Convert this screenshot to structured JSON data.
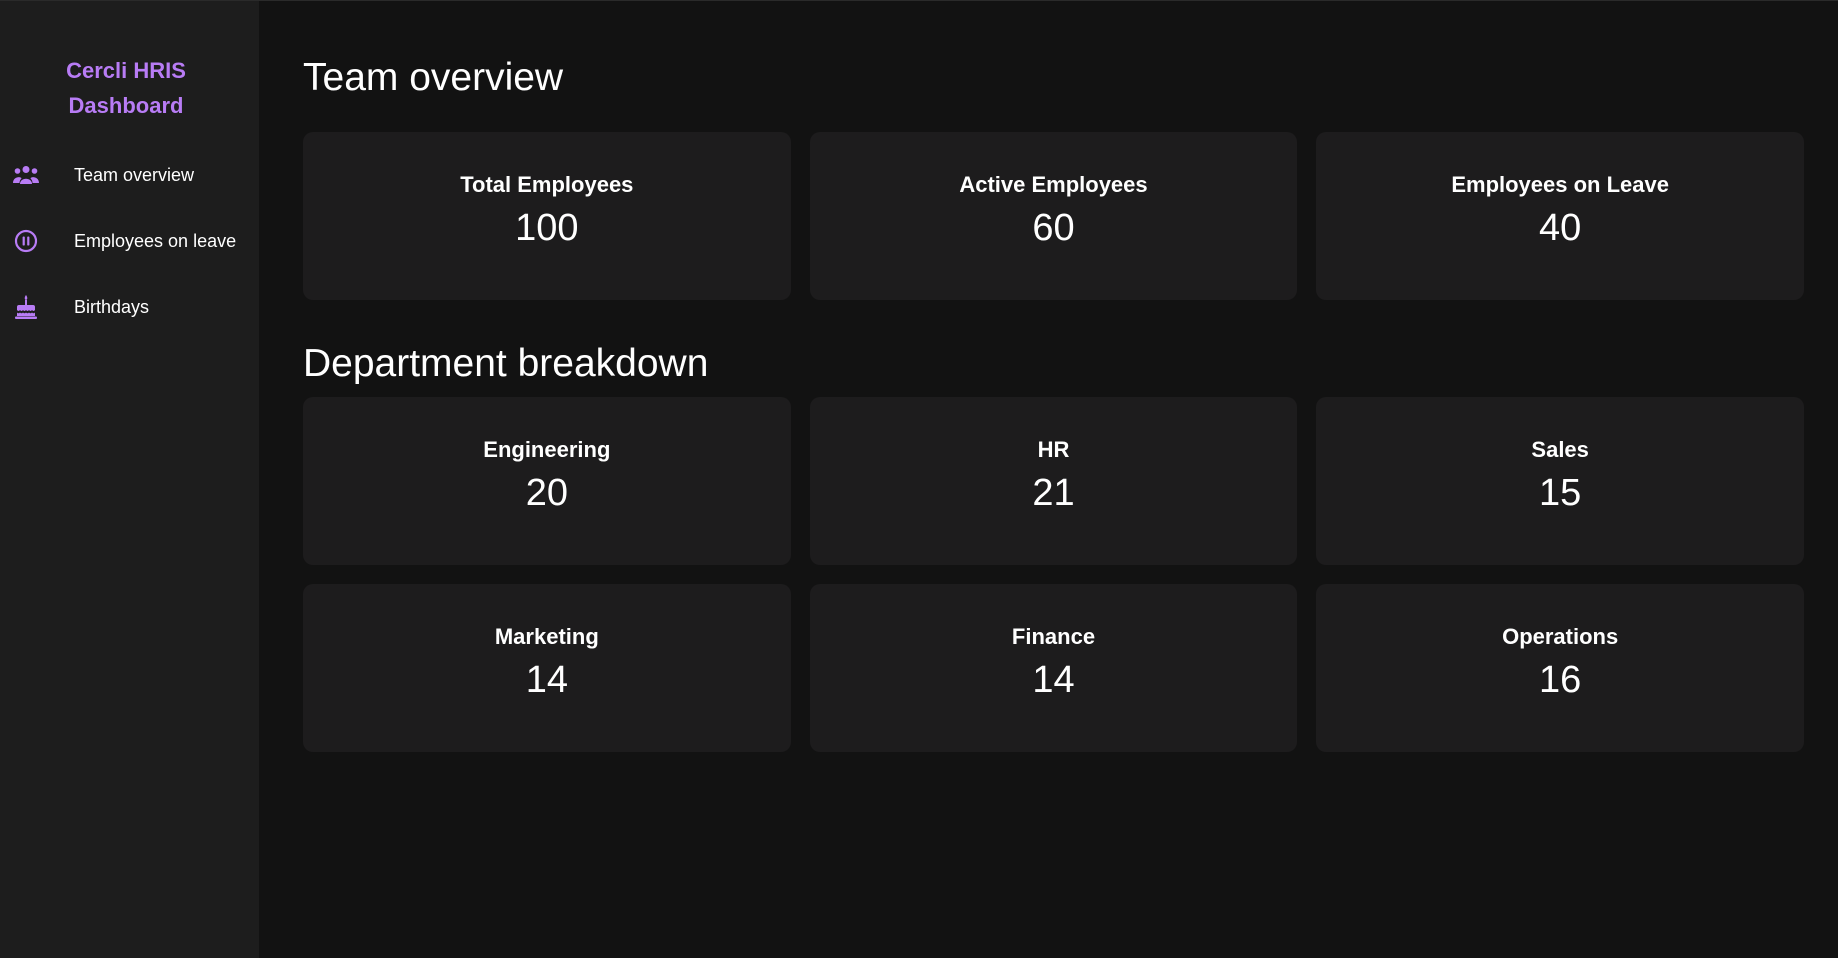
{
  "sidebar": {
    "brand_line1": "Cercli HRIS",
    "brand_line2": "Dashboard",
    "accent_color": "#b87cf5",
    "items": [
      {
        "label": "Team overview",
        "icon": "team-icon"
      },
      {
        "label": "Employees on leave",
        "icon": "pause-circle-icon"
      },
      {
        "label": "Birthdays",
        "icon": "birthday-cake-icon"
      }
    ]
  },
  "overview": {
    "title": "Team overview",
    "cards": [
      {
        "label": "Total Employees",
        "value": "100"
      },
      {
        "label": "Active Employees",
        "value": "60"
      },
      {
        "label": "Employees on Leave",
        "value": "40"
      }
    ]
  },
  "departments": {
    "title": "Department breakdown",
    "cards": [
      {
        "label": "Engineering",
        "value": "20"
      },
      {
        "label": "HR",
        "value": "21"
      },
      {
        "label": "Sales",
        "value": "15"
      },
      {
        "label": "Marketing",
        "value": "14"
      },
      {
        "label": "Finance",
        "value": "14"
      },
      {
        "label": "Operations",
        "value": "16"
      }
    ]
  }
}
